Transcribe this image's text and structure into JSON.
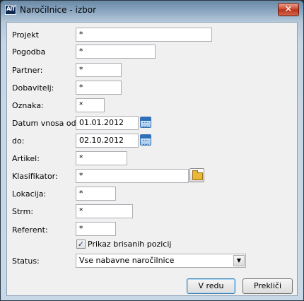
{
  "window": {
    "title": "Naročilnice - izbor",
    "app_icon_text": "AIT",
    "close_glyph": "✕"
  },
  "form": {
    "projekt": {
      "label": "Projekt",
      "value": "*"
    },
    "pogodba": {
      "label": "Pogodba",
      "value": "*"
    },
    "partner": {
      "label": "Partner:",
      "value": "*"
    },
    "dobavitelj": {
      "label": "Dobavitelj:",
      "value": "*"
    },
    "oznaka": {
      "label": "Oznaka:",
      "value": "*"
    },
    "datum_od": {
      "label": "Datum vnosa od:",
      "value": "01.01.2012"
    },
    "datum_do": {
      "label": "do:",
      "value": "02.10.2012"
    },
    "artikel": {
      "label": "Artikel:",
      "value": "*"
    },
    "klasifikator": {
      "label": "Klasifikator:",
      "value": "*"
    },
    "lokacija": {
      "label": "Lokacija:",
      "value": "*"
    },
    "strm": {
      "label": "Strm:",
      "value": "*"
    },
    "referent": {
      "label": "Referent:",
      "value": "*"
    },
    "prikaz_brisanih": {
      "label": "Prikaz brisanih pozicij",
      "checked": true,
      "check_glyph": "✓"
    },
    "status": {
      "label": "Status:",
      "value": "Vse nabavne naročilnice",
      "arrow_glyph": "▼"
    }
  },
  "buttons": {
    "ok": "V redu",
    "cancel": "Prekliči"
  },
  "icons": {
    "calendar": "calendar-icon",
    "folder": "folder-open-icon",
    "close": "close-icon"
  }
}
